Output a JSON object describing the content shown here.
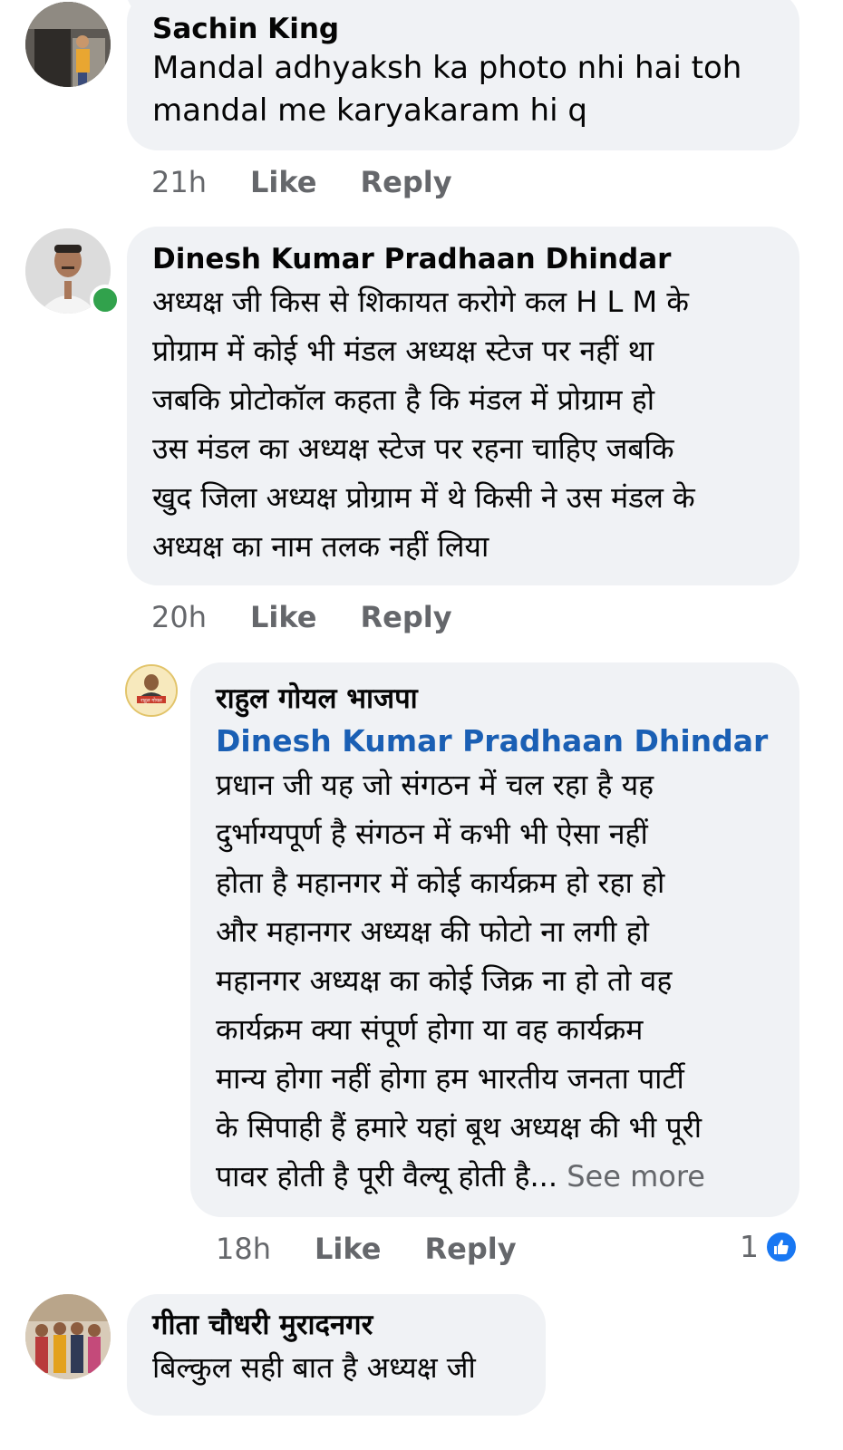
{
  "comments": [
    {
      "author": "Sachin King",
      "text": "Mandal adhyaksh ka photo nhi hai toh\nmandal me karyakaram hi q",
      "time": "21h",
      "like_label": "Like",
      "reply_label": "Reply"
    },
    {
      "author": "Dinesh Kumar Pradhaan Dhindar",
      "text": "अध्यक्ष जी किस से शिकायत करोगे कल H L M के\nप्रोग्राम में कोई भी मंडल अध्यक्ष स्टेज पर नहीं था\nजबकि प्रोटोकॉल कहता है कि मंडल में प्रोग्राम हो\nउस मंडल का अध्यक्ष स्टेज पर रहना चाहिए जबकि\nखुद जिला अध्यक्ष प्रोग्राम में थे किसी ने उस मंडल के\nअध्यक्ष का नाम तलक नहीं लिया",
      "time": "20h",
      "like_label": "Like",
      "reply_label": "Reply",
      "online": true
    },
    {
      "author": "राहुल गोयल भाजपा",
      "mention": "Dinesh Kumar Pradhaan Dhindar",
      "text": "प्रधान जी यह जो संगठन में चल रहा है यह\nदुर्भाग्यपूर्ण है संगठन में कभी भी ऐसा नहीं\nहोता है महानगर में कोई कार्यक्रम हो रहा हो\nऔर महानगर अध्यक्ष की फोटो ना लगी हो\nमहानगर अध्यक्ष का कोई जिक्र ना हो तो वह\nकार्यक्रम क्या संपूर्ण होगा या वह कार्यक्रम\nमान्य होगा नहीं होगा हम भारतीय जनता पार्टी\nके सिपाही हैं हमारे यहां बूथ अध्यक्ष की भी पूरी\nपावर होती है पूरी वैल्यू होती है...",
      "see_more": "See more",
      "time": "18h",
      "like_label": "Like",
      "reply_label": "Reply",
      "reaction_count": "1",
      "reaction_icon": "thumbs-up-icon",
      "avatar_badge_text": "राहुल गोयल"
    },
    {
      "author": "गीता चौधरी मुरादनगर",
      "text": "बिल्कुल सही बात है अध्यक्ष जी"
    }
  ],
  "colors": {
    "bubble": "#f0f2f5",
    "mention": "#1a5fb4",
    "meta": "#65676b",
    "like_badge": "#1877f2",
    "online": "#31a24c"
  }
}
